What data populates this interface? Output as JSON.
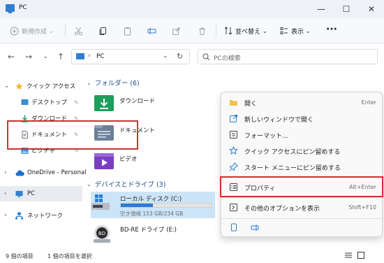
{
  "window": {
    "title": "PC",
    "buttons": {
      "minimize": "—",
      "maximize": "☐",
      "close": "✕"
    }
  },
  "toolbar": {
    "new_label": "新規作成",
    "sort_label": "並べ替え",
    "view_label": "表示",
    "more_label": "···"
  },
  "nav": {
    "back": "←",
    "forward": "→",
    "history": "⌄",
    "up": "↑",
    "address_sep": "›",
    "address_text": "PC",
    "address_dd": "⌄",
    "refresh": "↻",
    "search_placeholder": "PCの検索"
  },
  "sidebar": {
    "items": [
      {
        "label": "クイック アクセス",
        "chevron": "⌄",
        "icon": "star-icon"
      },
      {
        "label": "デスクトップ",
        "icon": "desktop-icon",
        "pinned": true
      },
      {
        "label": "ダウンロード",
        "icon": "download-icon",
        "pinned": true
      },
      {
        "label": "ドキュメント",
        "icon": "document-icon",
        "pinned": true
      },
      {
        "label": "ピクチャ",
        "icon": "picture-icon",
        "pinned": true
      },
      {
        "label": "OneDrive - Personal",
        "chevron": "›",
        "icon": "cloud-icon"
      },
      {
        "label": "PC",
        "chevron": "›",
        "icon": "pc-icon",
        "selected": true
      },
      {
        "label": "ネットワーク",
        "chevron": "›",
        "icon": "network-icon"
      }
    ],
    "pin_glyph": "📌"
  },
  "main": {
    "folders_header": "フォルダー (6)",
    "folders": [
      {
        "label": "ダウンロード",
        "icon": "download-folder-icon"
      },
      {
        "label": "ドキュメント",
        "icon": "documents-folder-icon"
      },
      {
        "label": "ビデオ",
        "icon": "videos-folder-icon"
      }
    ],
    "drives_header": "デバイスとドライブ (3)",
    "drives": [
      {
        "name": "ローカル ディスク (C:)",
        "free": "空き領域 153 GB/234 GB",
        "used_fraction": 0.35
      },
      {
        "name": "BD-RE ドライブ (E:)"
      }
    ]
  },
  "status": {
    "count": "9 個の項目",
    "selected": "1 個の項目を選択"
  },
  "context_menu": {
    "items": [
      {
        "label": "開く",
        "shortcut": "Enter",
        "icon": "open-folder-icon"
      },
      {
        "label": "新しいウィンドウで開く",
        "shortcut": "",
        "icon": "new-window-icon"
      },
      {
        "label": "フォーマット...",
        "shortcut": "",
        "icon": "format-icon"
      },
      {
        "label": "クイック アクセスにピン留めする",
        "shortcut": "",
        "icon": "star-outline-icon"
      },
      {
        "label": "スタート メニューにピン留めする",
        "shortcut": "",
        "icon": "pin-icon"
      },
      {
        "label": "プロパティ",
        "shortcut": "Alt+Enter",
        "icon": "properties-icon"
      },
      {
        "label": "その他のオプションを表示",
        "shortcut": "Shift+F10",
        "icon": "more-options-icon"
      }
    ]
  }
}
